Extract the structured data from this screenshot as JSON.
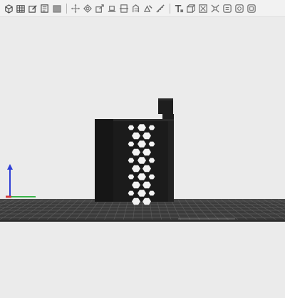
{
  "toolbar": {
    "tools": [
      {
        "name": "add-object-icon",
        "group": 1
      },
      {
        "name": "grid-view-icon",
        "group": 1
      },
      {
        "name": "edit-object-icon",
        "group": 1
      },
      {
        "name": "copy-icon",
        "group": 1
      },
      {
        "name": "solid-view-icon",
        "group": 1
      },
      {
        "name": "move-icon",
        "group": 2
      },
      {
        "name": "rotate-icon",
        "group": 2
      },
      {
        "name": "scale-icon",
        "group": 2
      },
      {
        "name": "place-on-face-icon",
        "group": 2
      },
      {
        "name": "cut-icon",
        "group": 2
      },
      {
        "name": "support-paint-icon",
        "group": 2
      },
      {
        "name": "seam-paint-icon",
        "group": 2
      },
      {
        "name": "measure-icon",
        "group": 2
      },
      {
        "name": "text-icon",
        "group": 3
      },
      {
        "name": "assembly-icon",
        "group": 3
      },
      {
        "name": "split-icon",
        "group": 3
      },
      {
        "name": "explode-icon",
        "group": 3
      },
      {
        "name": "layers-icon",
        "group": 3
      },
      {
        "name": "view-settings-icon",
        "group": 3
      },
      {
        "name": "more-icon",
        "group": 3
      }
    ]
  },
  "colors": {
    "background": "#ebebeb",
    "plate": "#3a3a3a",
    "plate_grid": "#5a5a5a",
    "model": "#1c1c1c",
    "axis_x": "#d23b3b",
    "axis_y": "#3bb54a",
    "axis_z": "#2f3fd6"
  }
}
